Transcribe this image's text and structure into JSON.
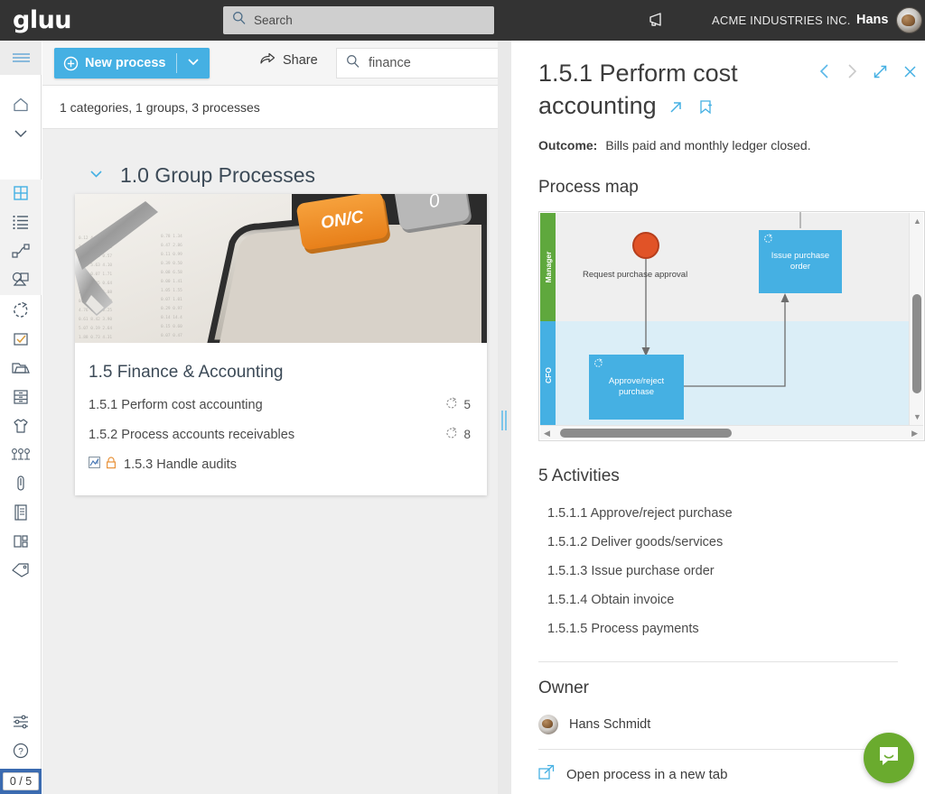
{
  "topbar": {
    "logo": "gluu",
    "search_placeholder": "Search",
    "search_value": "",
    "search_icon": "search-icon",
    "megaphone_icon": "megaphone-icon",
    "org_name": "ACME INDUSTRIES INC.",
    "user_name": "Hans",
    "avatar_icon": "user-avatar"
  },
  "rail": {
    "hamburger_icon": "hamburger-menu-icon",
    "items": [
      {
        "name": "home",
        "icon": "home-icon"
      },
      {
        "name": "chevron-down",
        "icon": "chevron-down-icon"
      },
      {
        "name": "grid",
        "icon": "grid-icon",
        "active": true
      },
      {
        "name": "list",
        "icon": "list-icon"
      },
      {
        "name": "flow",
        "icon": "flow-connector-icon"
      },
      {
        "name": "shapes",
        "icon": "shapes-icon"
      },
      {
        "name": "process",
        "icon": "process-circle-icon"
      },
      {
        "name": "task",
        "icon": "checkbox-icon"
      },
      {
        "name": "folder",
        "icon": "folder-icon"
      },
      {
        "name": "archive",
        "icon": "archive-icon"
      },
      {
        "name": "shirt",
        "icon": "shirt-icon"
      },
      {
        "name": "people",
        "icon": "people-icon"
      },
      {
        "name": "attachment",
        "icon": "paperclip-icon"
      },
      {
        "name": "document",
        "icon": "document-icon"
      },
      {
        "name": "dashboard",
        "icon": "dashboard-icon"
      },
      {
        "name": "tag",
        "icon": "tag-icon"
      }
    ],
    "settings_icon": "sliders-icon",
    "help_icon": "question-circle-icon",
    "counter": "0 / 5"
  },
  "toolbar": {
    "new_process_label": "New process",
    "new_process_icon": "plus-circle-icon",
    "new_process_caret_icon": "chevron-down-icon",
    "share_label": "Share",
    "share_icon": "share-icon",
    "search_icon": "search-icon",
    "search_value": "finance",
    "clear_icon": "close-icon",
    "accent_color": "#45b0e3"
  },
  "left": {
    "summary": "1 categories, 1 groups, 3 processes",
    "group": {
      "collapse_icon": "chevron-down-icon",
      "title": "1.0 Group Processes"
    },
    "card": {
      "photo_alt": "calculator-and-pen-on-spreadsheet-photo",
      "title": "1.5 Finance & Accounting",
      "rows": [
        {
          "label": "1.5.1 Perform cost accounting",
          "count": "5",
          "count_icon": "process-circle-icon",
          "icons": []
        },
        {
          "label": "1.5.2 Process accounts receivables",
          "count": "8",
          "count_icon": "process-circle-icon",
          "icons": []
        },
        {
          "label": "1.5.3 Handle audits",
          "count": "",
          "count_icon": "",
          "icons": [
            "chart-icon",
            "lock-icon"
          ]
        }
      ]
    }
  },
  "splitter": {
    "handle_icon": "drag-handle-icon"
  },
  "right": {
    "title": "1.5.1 Perform cost accounting",
    "title_inline_icons": [
      "open-external-icon",
      "bookmark-icon"
    ],
    "actions": [
      {
        "name": "prev",
        "icon": "chevron-left-icon"
      },
      {
        "name": "next",
        "icon": "chevron-right-icon"
      },
      {
        "name": "expand",
        "icon": "expand-diagonal-icon"
      },
      {
        "name": "close",
        "icon": "close-icon"
      }
    ],
    "outcome_label": "Outcome:",
    "outcome_value": "Bills paid and monthly ledger closed.",
    "process_map_heading": "Process map",
    "process_map": {
      "lanes": [
        {
          "name": "Manager",
          "color": "#5fa83d",
          "bg": "#efefef"
        },
        {
          "name": "CFO",
          "color": "#45b0e3",
          "bg": "#dbeef7"
        }
      ],
      "start_event": {
        "label": "Request purchase approval",
        "color": "#e15327"
      },
      "tasks": [
        {
          "label": "Issue purchase order",
          "lane": "Manager",
          "color": "#45b0e3",
          "icon": "process-circle-icon"
        },
        {
          "label": "Approve/reject purchase",
          "lane": "CFO",
          "color": "#45b0e3",
          "icon": "process-circle-icon"
        }
      ],
      "scroll_up_icon": "triangle-up-icon",
      "scroll_down_icon": "triangle-down-icon",
      "scroll_left_icon": "triangle-left-icon",
      "scroll_right_icon": "triangle-right-icon"
    },
    "activities_heading": "5 Activities",
    "activities": [
      "1.5.1.1 Approve/reject purchase",
      "1.5.1.2 Deliver goods/services",
      "1.5.1.3 Issue purchase order",
      "1.5.1.4 Obtain invoice",
      "1.5.1.5 Process payments"
    ],
    "owner_heading": "Owner",
    "owner_name": "Hans Schmidt",
    "owner_avatar_icon": "user-avatar",
    "open_tab_label": "Open process in a new tab",
    "open_tab_icon": "open-external-icon"
  },
  "intercom": {
    "icon": "chat-bubble-icon",
    "color": "#6aab2e"
  }
}
